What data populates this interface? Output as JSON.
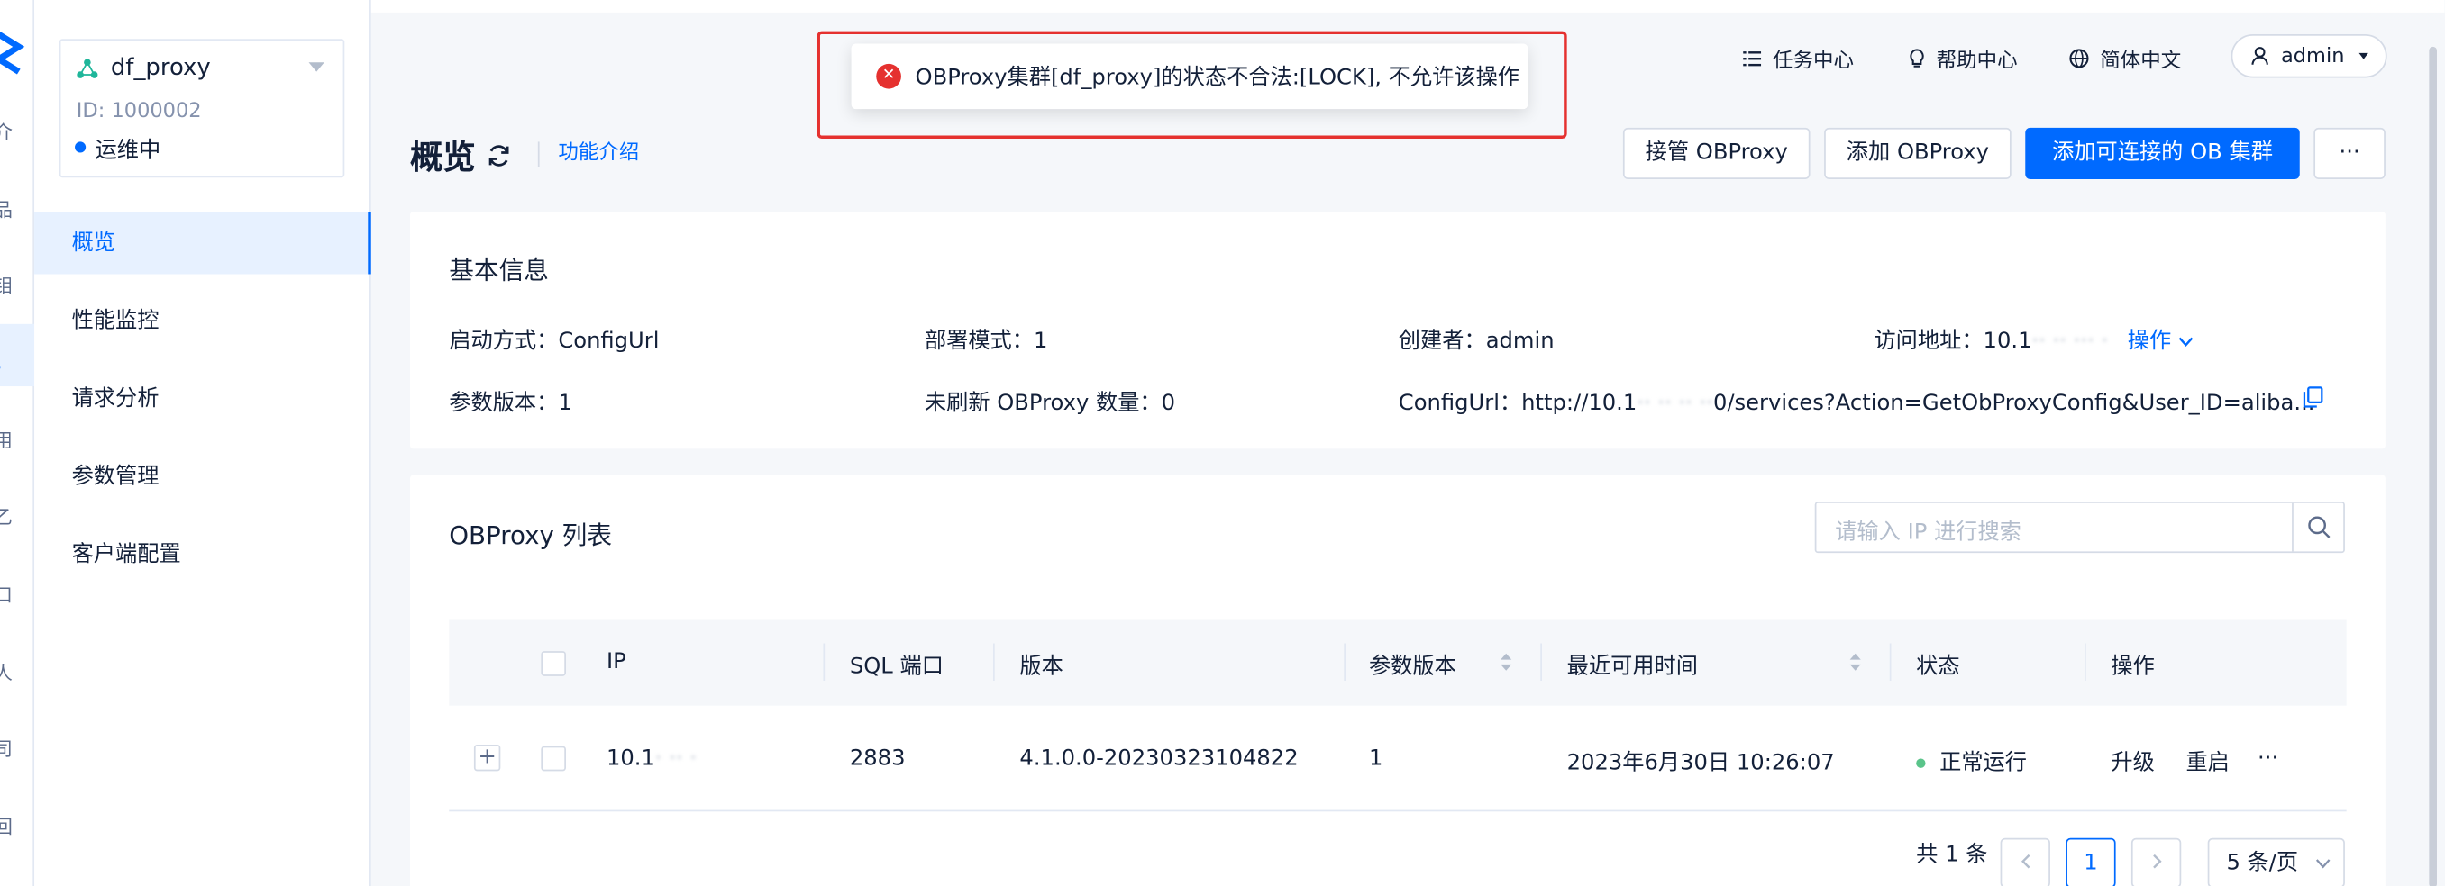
{
  "toast": {
    "message": "OBProxy集群[df_proxy]的状态不合法:[LOCK], 不允许该操作"
  },
  "topbar": {
    "task_center": "任务中心",
    "help_center": "帮助中心",
    "language": "简体中文",
    "user": "admin"
  },
  "cluster_card": {
    "name": "df_proxy",
    "id": "ID: 1000002",
    "status": "运维中"
  },
  "sidebar": {
    "items": [
      {
        "label": "概览",
        "active": true
      },
      {
        "label": "性能监控"
      },
      {
        "label": "请求分析"
      },
      {
        "label": "参数管理"
      },
      {
        "label": "客户端配置"
      }
    ]
  },
  "rail_glyphs": [
    "介",
    "品",
    "钼",
    "。",
    "用",
    "乙",
    "口",
    "人",
    "司",
    "回"
  ],
  "page": {
    "title": "概览",
    "func_intro": "功能介绍",
    "buttons": {
      "takeover": "接管 OBProxy",
      "add_proxy": "添加 OBProxy",
      "add_cluster": "添加可连接的 OB 集群",
      "more": "···"
    }
  },
  "basic_info": {
    "title": "基本信息",
    "start_mode": {
      "key": "启动方式：",
      "value": "ConfigUrl"
    },
    "deploy_mode": {
      "key": "部署模式：",
      "value": "1"
    },
    "creator": {
      "key": "创建者：",
      "value": "admin"
    },
    "access": {
      "key": "访问地址：",
      "value_prefix": "10.1",
      "value_blur": "·· ·· ··· ·",
      "op": "操作"
    },
    "param_version": {
      "key": "参数版本：",
      "value": "1"
    },
    "unrefreshed": {
      "key": "未刷新 OBProxy 数量：",
      "value": "0"
    },
    "config_url": {
      "key": "ConfigUrl：",
      "value_prefix": "http://10.1",
      "value_blur": "·· ·· ·· ··",
      "value_suffix": "0/services?Action=GetObProxyConfig&User_ID=aliba..."
    }
  },
  "proxy_list": {
    "title": "OBProxy 列表",
    "search_placeholder": "请输入 IP 进行搜索",
    "columns": [
      "IP",
      "SQL 端口",
      "版本",
      "参数版本",
      "最近可用时间",
      "状态",
      "操作"
    ],
    "rows": [
      {
        "ip_prefix": "10.1",
        "ip_blur": "· ·· ·",
        "sql_port": "2883",
        "version": "4.1.0.0-20230323104822",
        "param_version": "1",
        "last_available": "2023年6月30日 10:26:07",
        "status": "正常运行",
        "actions": {
          "upgrade": "升级",
          "restart": "重启",
          "more": "···"
        }
      }
    ],
    "pagination": {
      "total": "共 1 条",
      "current_page": "1",
      "page_size": "5 条/页"
    }
  },
  "colors": {
    "primary": "#006aff",
    "error": "#e5312f",
    "success": "#5ac48a",
    "background": "#f5f7fa"
  }
}
